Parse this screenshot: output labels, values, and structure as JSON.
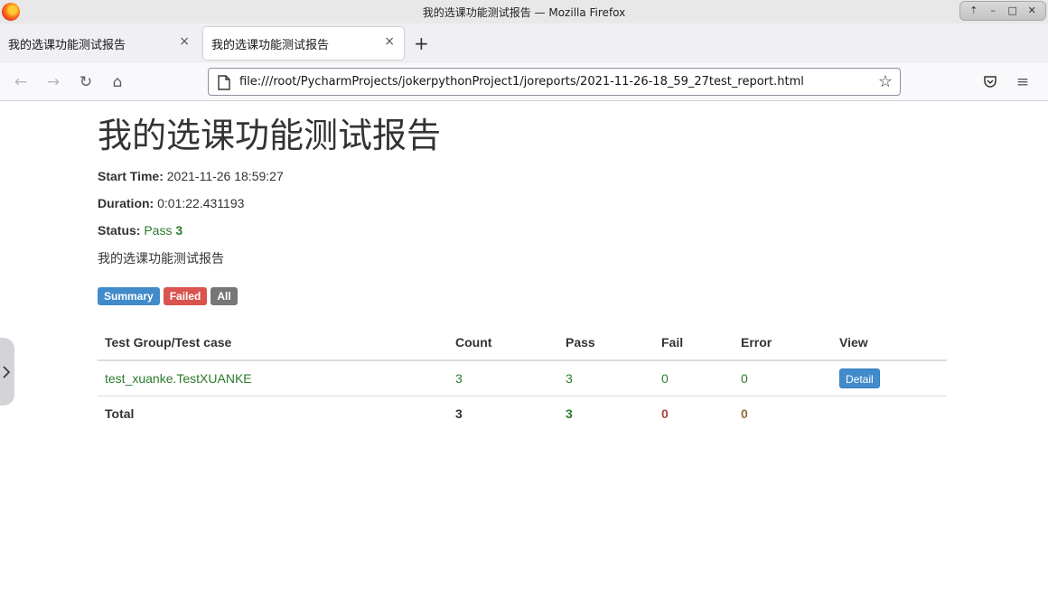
{
  "window": {
    "title": "我的选课功能测试报告 — Mozilla Firefox",
    "controls": [
      "⇡",
      "–",
      "□",
      "✕"
    ]
  },
  "tabs": [
    {
      "label": "我的选课功能测试报告",
      "close": "×"
    },
    {
      "label": "我的选课功能测试报告",
      "close": "×"
    }
  ],
  "new_tab": "+",
  "nav": {
    "url": "file:///root/PycharmProjects/jokerpythonProject1/joreports/2021-11-26-18_59_27test_report.html",
    "back_icon": "←",
    "forward_icon": "→",
    "reload_icon": "↻",
    "home_icon": "⌂",
    "star_icon": "☆",
    "pocket_icon": "pocket-icon",
    "menu_icon": "≡"
  },
  "report": {
    "heading": "我的选课功能测试报告",
    "start_label": "Start Time:",
    "start_value": "2021-11-26 18:59:27",
    "duration_label": "Duration:",
    "duration_value": "0:01:22.431193",
    "status_label": "Status:",
    "status_pass": "Pass",
    "status_count": "3",
    "description": "我的选课功能测试报告",
    "filters": {
      "summary": "Summary",
      "failed": "Failed",
      "all": "All"
    },
    "table": {
      "headers": [
        "Test Group/Test case",
        "Count",
        "Pass",
        "Fail",
        "Error",
        "View"
      ],
      "row": {
        "name": "test_xuanke.TestXUANKE",
        "count": "3",
        "pass": "3",
        "fail": "0",
        "error": "0",
        "view": "Detail"
      },
      "total": {
        "label": "Total",
        "count": "3",
        "pass": "3",
        "fail": "0",
        "error": "0"
      }
    }
  },
  "colors": {
    "pass": "#2b7a2b",
    "fail": "#a94442",
    "error": "#8a6d3b",
    "primary": "#428bca",
    "danger": "#d9534f"
  }
}
